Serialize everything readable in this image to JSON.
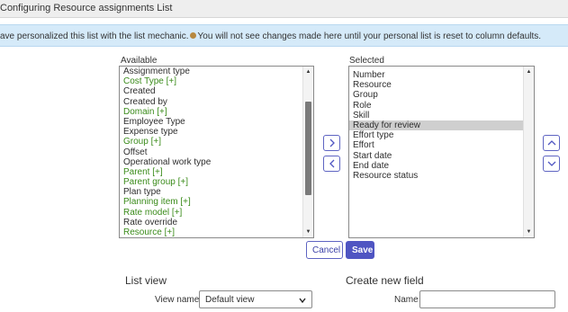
{
  "header": {
    "title": "Configuring Resource assignments List"
  },
  "info_banner": {
    "text_before": "ave personalized this list with the list mechanic.",
    "text_after": "You will not see changes made here until your personal list is reset to column defaults."
  },
  "available": {
    "label": "Available",
    "items": [
      {
        "label": "Assignment type",
        "ref": false
      },
      {
        "label": "Cost Type [+]",
        "ref": true
      },
      {
        "label": "Created",
        "ref": false
      },
      {
        "label": "Created by",
        "ref": false
      },
      {
        "label": "Domain [+]",
        "ref": true
      },
      {
        "label": "Employee Type",
        "ref": false
      },
      {
        "label": "Expense type",
        "ref": false
      },
      {
        "label": "Group [+]",
        "ref": true
      },
      {
        "label": "Offset",
        "ref": false
      },
      {
        "label": "Operational work type",
        "ref": false
      },
      {
        "label": "Parent [+]",
        "ref": true
      },
      {
        "label": "Parent group [+]",
        "ref": true
      },
      {
        "label": "Plan type",
        "ref": false
      },
      {
        "label": "Planning item [+]",
        "ref": true
      },
      {
        "label": "Rate model [+]",
        "ref": true
      },
      {
        "label": "Rate override",
        "ref": false
      },
      {
        "label": "Resource [+]",
        "ref": true
      }
    ],
    "scroll_position": 0.35
  },
  "selected": {
    "label": "Selected",
    "items": [
      {
        "label": "Number",
        "selected": false
      },
      {
        "label": "Resource",
        "selected": false
      },
      {
        "label": "Group",
        "selected": false
      },
      {
        "label": "Role",
        "selected": false
      },
      {
        "label": "Skill",
        "selected": false
      },
      {
        "label": "Ready for review",
        "selected": true
      },
      {
        "label": "Effort type",
        "selected": false
      },
      {
        "label": "Effort",
        "selected": false
      },
      {
        "label": "Start date",
        "selected": false
      },
      {
        "label": "End date",
        "selected": false
      },
      {
        "label": "Resource status",
        "selected": false
      }
    ]
  },
  "icons": {
    "add": "chevron-right-icon",
    "remove": "chevron-left-icon",
    "move_up": "chevron-up-icon",
    "move_down": "chevron-down-icon",
    "info": "info-dot-icon"
  },
  "buttons": {
    "cancel": "Cancel",
    "save": "Save"
  },
  "list_view": {
    "title": "List view",
    "view_name_label": "View name",
    "view_name_value": "Default view"
  },
  "create_field": {
    "title": "Create new field",
    "name_label": "Name",
    "name_value": ""
  },
  "colors": {
    "accent": "#4f55c2",
    "reference_field": "#3a8b1a",
    "banner": "#d5eaf9",
    "selection": "#cfcfcf"
  }
}
